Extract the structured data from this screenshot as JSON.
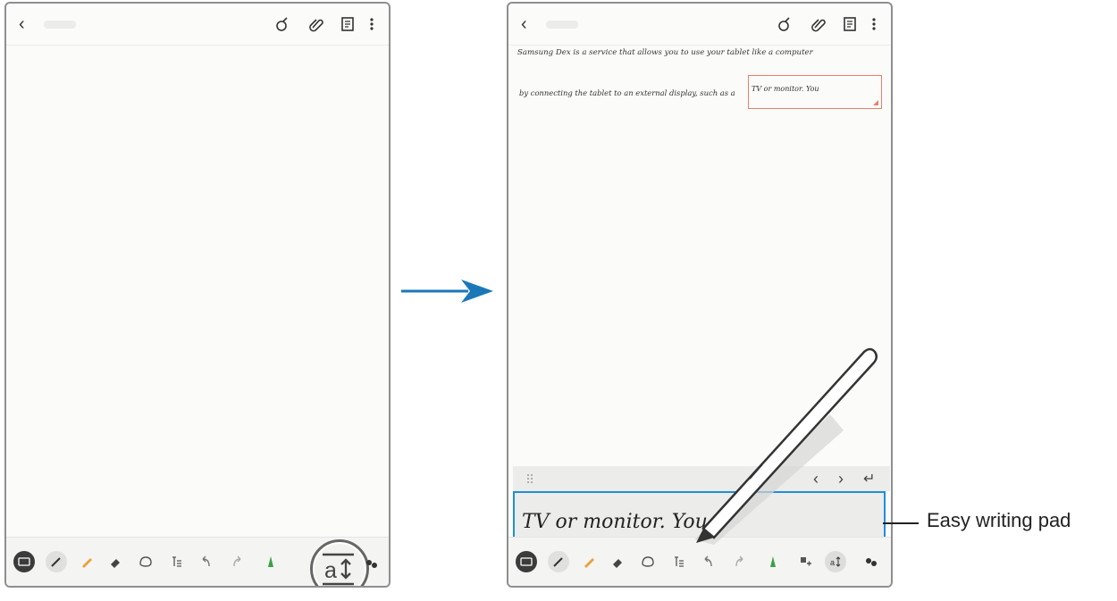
{
  "left_screen": {
    "toolbar_tools": [
      "keyboard-icon",
      "pen-icon",
      "highlighter-icon",
      "eraser-icon",
      "lasso-icon",
      "text-style-icon",
      "undo-icon",
      "redo-icon",
      "color-icon",
      "insert-icon",
      "easy-writing-pad-icon",
      "more-icon"
    ]
  },
  "right_screen": {
    "note_text": {
      "line1": "Samsung Dex is a service that allows you to use your tablet like a computer",
      "line2": "by connecting the tablet to an external display, such as a",
      "box_text": "TV or monitor. You"
    },
    "pad": {
      "handwriting": "TV or monitor. You"
    }
  },
  "callout": {
    "label": "Easy writing pad"
  },
  "colors": {
    "arrow": "#1a78b8",
    "pad_border": "#1f8fd8",
    "box_border": "#e7806a"
  }
}
